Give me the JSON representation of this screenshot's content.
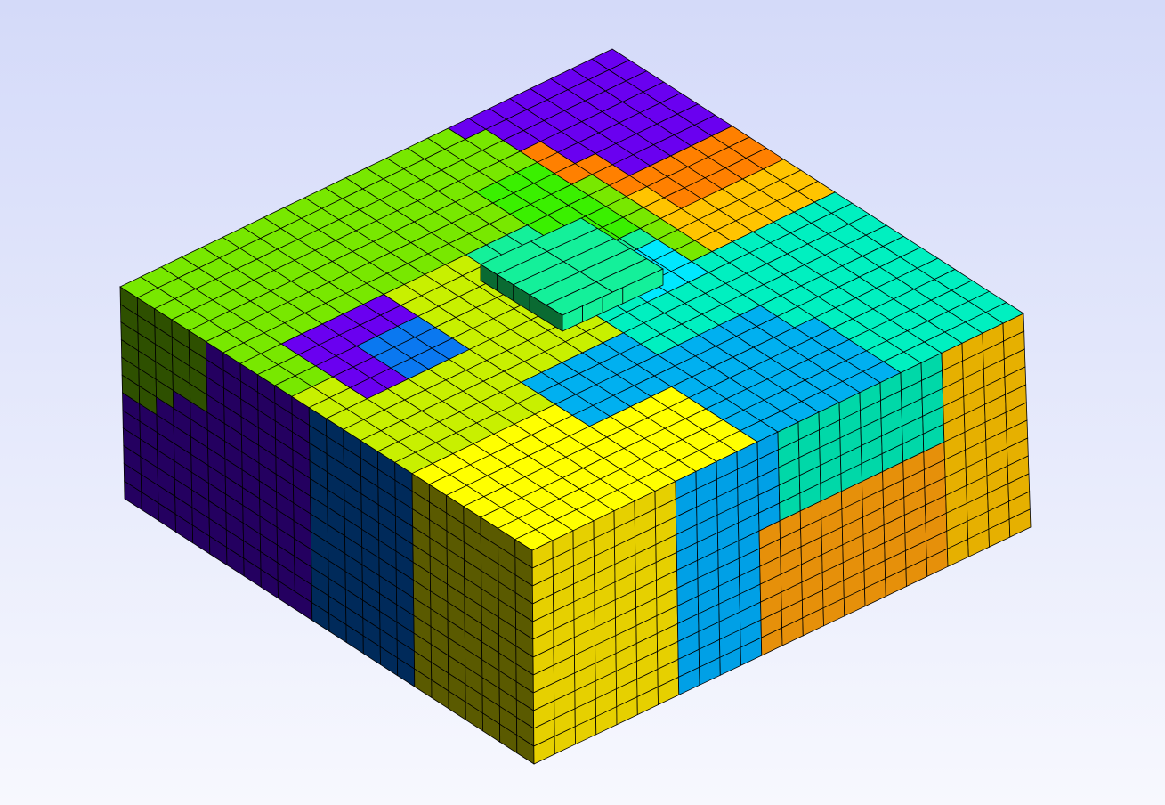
{
  "viewport": {
    "background_top": "#d4daf9",
    "background_bottom": "#f7f8fe"
  },
  "mesh": {
    "grid_columns": 24,
    "grid_rows": 24,
    "depth_layers": 12,
    "edge_color": "#000000",
    "partition_colors": {
      "purple": "#6a00f0",
      "orange": "#ff8000",
      "gold": "#ffc400",
      "lime_light": "#8cea00",
      "lime": "#78e800",
      "green_bright": "#3af000",
      "green_mid": "#14f45a",
      "mint": "#14f09a",
      "cyan": "#00e8ff",
      "aqua": "#00f0c0",
      "sky": "#00b0f0",
      "azure": "#0a78f0",
      "yellow_green": "#c8f000",
      "yellow": "#ffff00"
    },
    "left_side_colors": {
      "olive": "#2e5000",
      "indigo": "#240060",
      "navy": "#002a5a",
      "olive_yellow": "#5a5a00"
    },
    "right_side_colors": {
      "yellow": "#e6d000",
      "sky": "#00a0e6",
      "orange": "#e6900a",
      "aqua": "#00d8a8",
      "gold": "#e6b000"
    }
  }
}
